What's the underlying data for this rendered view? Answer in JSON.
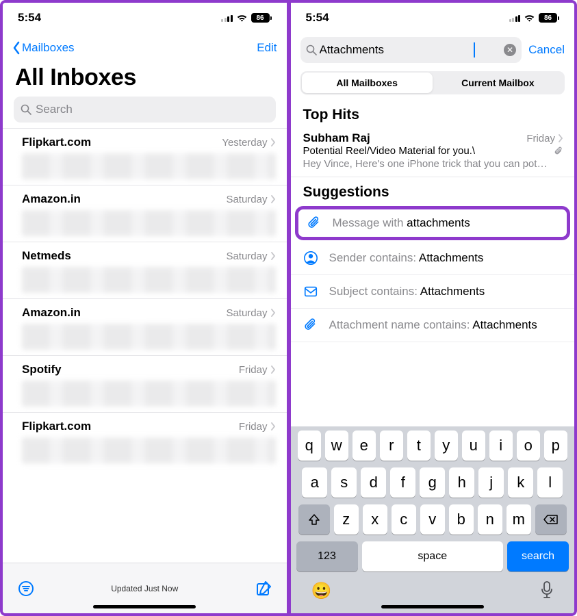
{
  "status": {
    "time": "5:54",
    "battery": "86"
  },
  "left": {
    "back_label": "Mailboxes",
    "edit_label": "Edit",
    "title": "All Inboxes",
    "search_placeholder": "Search",
    "messages": [
      {
        "sender": "Flipkart.com",
        "date": "Yesterday"
      },
      {
        "sender": "Amazon.in",
        "date": "Saturday"
      },
      {
        "sender": "Netmeds",
        "date": "Saturday"
      },
      {
        "sender": "Amazon.in",
        "date": "Saturday"
      },
      {
        "sender": "Spotify",
        "date": "Friday"
      },
      {
        "sender": "Flipkart.com",
        "date": "Friday"
      }
    ],
    "toolbar_status": "Updated Just Now"
  },
  "right": {
    "search_value": "Attachments",
    "cancel": "Cancel",
    "scope": {
      "all": "All Mailboxes",
      "current": "Current Mailbox"
    },
    "top_hits_label": "Top Hits",
    "top_hit": {
      "name": "Subham Raj",
      "date": "Friday",
      "subject": "Potential Reel/Video Material for you.\\",
      "preview": "Hey Vince, Here's one iPhone trick that you can pot…"
    },
    "suggestions_label": "Suggestions",
    "suggestions": {
      "s1_prefix": "Message with ",
      "s1_bold": "attachments",
      "s2_prefix": "Sender contains: ",
      "s2_bold": "Attachments",
      "s3_prefix": "Subject contains: ",
      "s3_bold": "Attachments",
      "s4_prefix": "Attachment name contains: ",
      "s4_bold": "Attachments"
    },
    "keyboard": {
      "row1": [
        "q",
        "w",
        "e",
        "r",
        "t",
        "y",
        "u",
        "i",
        "o",
        "p"
      ],
      "row2": [
        "a",
        "s",
        "d",
        "f",
        "g",
        "h",
        "j",
        "k",
        "l"
      ],
      "row3": [
        "z",
        "x",
        "c",
        "v",
        "b",
        "n",
        "m"
      ],
      "k123": "123",
      "space": "space",
      "search": "search"
    }
  }
}
